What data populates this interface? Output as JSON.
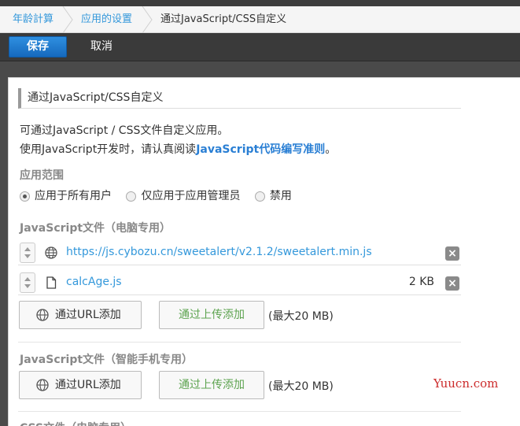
{
  "breadcrumb": {
    "items": [
      {
        "label": "年龄計算",
        "kind": "link"
      },
      {
        "label": "应用的设置",
        "kind": "link"
      },
      {
        "label": "通过JavaScript/CSS自定义",
        "kind": "current"
      }
    ]
  },
  "toolbar": {
    "save_label": "保存",
    "cancel_label": "取消"
  },
  "section": {
    "title": "通过JavaScript/CSS自定义",
    "desc_line1": "可通过JavaScript / CSS文件自定义应用。",
    "desc_line2_prefix": "使用JavaScript开发时，请认真阅读",
    "desc_line2_link": "JavaScript代码编写准则",
    "desc_line2_suffix": "。"
  },
  "scope": {
    "label": "应用范围",
    "options": [
      {
        "label": "应用于所有用户",
        "checked": true
      },
      {
        "label": "仅应用于应用管理员",
        "checked": false
      },
      {
        "label": "禁用",
        "checked": false
      }
    ]
  },
  "js_pc": {
    "label": "JavaScript文件（电脑专用）",
    "files": [
      {
        "name": "https://js.cybozu.cn/sweetalert/v2.1.2/sweetalert.min.js",
        "icon": "globe-icon",
        "size": ""
      },
      {
        "name": "calcAge.js",
        "icon": "file-icon",
        "size": "2 KB"
      }
    ],
    "add_url_label": "通过URL添加",
    "upload_label": "通过上传添加",
    "max_note": "(最大20 MB)"
  },
  "js_mobile": {
    "label": "JavaScript文件（智能手机专用）",
    "add_url_label": "通过URL添加",
    "upload_label": "通过上传添加",
    "max_note": "(最大20 MB)"
  },
  "css_pc": {
    "label": "CSS文件（电脑专用）"
  },
  "watermark": "Yuucn.com",
  "colors": {
    "accent": "#3498db",
    "save_button": "#1f7ad1",
    "toolbar": "#3a3a3a",
    "upload_text": "#5da34f",
    "watermark": "#cc2b2b"
  }
}
